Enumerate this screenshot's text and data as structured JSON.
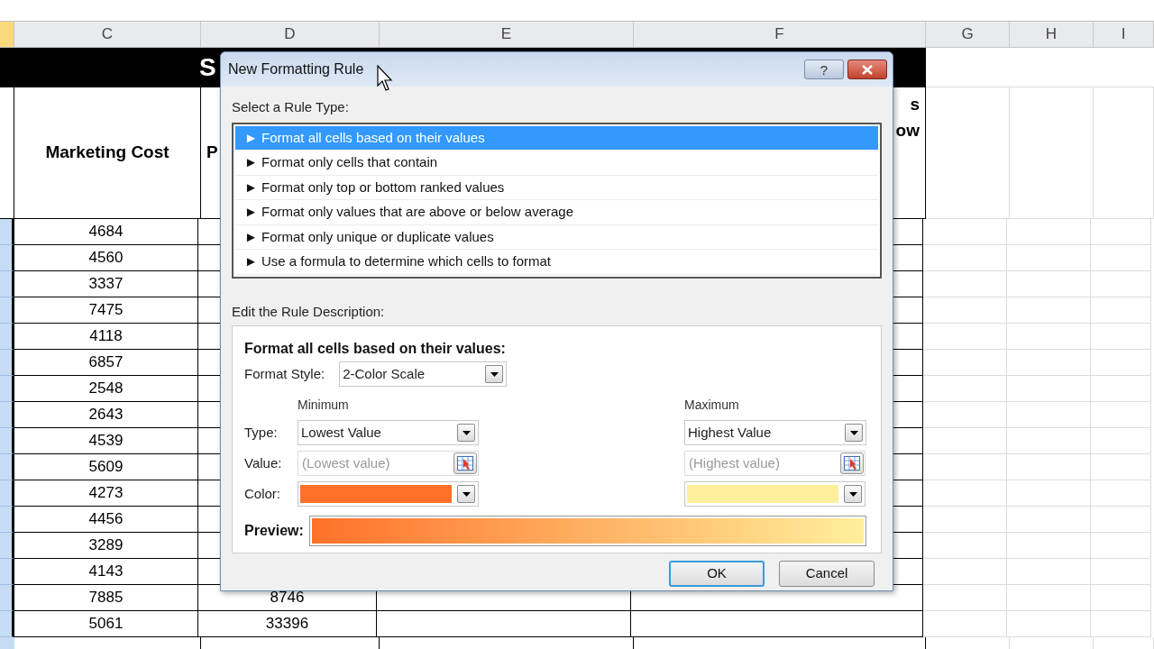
{
  "sheet": {
    "columns": [
      "C",
      "D",
      "E",
      "F",
      "G",
      "H",
      "I"
    ],
    "title_fragment": "S",
    "header": {
      "c": "Marketing Cost",
      "d": "P",
      "f_lines": [
        "s",
        "ow"
      ]
    },
    "rows": [
      {
        "c": "4684"
      },
      {
        "c": "4560"
      },
      {
        "c": "3337"
      },
      {
        "c": "7475"
      },
      {
        "c": "4118"
      },
      {
        "c": "6857"
      },
      {
        "c": "2548"
      },
      {
        "c": "2643"
      },
      {
        "c": "4539"
      },
      {
        "c": "5609"
      },
      {
        "c": "4273"
      },
      {
        "c": "4456"
      },
      {
        "c": "3289"
      },
      {
        "c": "4143"
      },
      {
        "c": "7885",
        "d": "8746"
      },
      {
        "c": "5061",
        "d": "33396"
      }
    ]
  },
  "dialog": {
    "title": "New Formatting Rule",
    "help": "?",
    "rule_type_label": "Select a Rule Type:",
    "rule_types": [
      {
        "label": "► Format all cells based on their values",
        "selected": true
      },
      {
        "label": "► Format only cells that contain",
        "selected": false
      },
      {
        "label": "► Format only top or bottom ranked values",
        "selected": false
      },
      {
        "label": "► Format only values that are above or below average",
        "selected": false
      },
      {
        "label": "► Format only unique or duplicate values",
        "selected": false
      },
      {
        "label": "► Use a formula to determine which cells to format",
        "selected": false
      }
    ],
    "description_label": "Edit the Rule Description:",
    "description": {
      "heading": "Format all cells based on their values:",
      "format_style_label": "Format Style:",
      "format_style": "2-Color Scale",
      "type_label": "Type:",
      "value_label": "Value:",
      "color_label": "Color:",
      "preview_label": "Preview:",
      "minimum": {
        "heading": "Minimum",
        "type": "Lowest Value",
        "value_placeholder": "(Lowest value)",
        "color": "#ff7128"
      },
      "maximum": {
        "heading": "Maximum",
        "type": "Highest Value",
        "value_placeholder": "(Highest value)",
        "color": "#ffef9c"
      }
    },
    "buttons": [
      {
        "label": "OK",
        "default": true
      },
      {
        "label": "Cancel",
        "default": false
      }
    ]
  }
}
